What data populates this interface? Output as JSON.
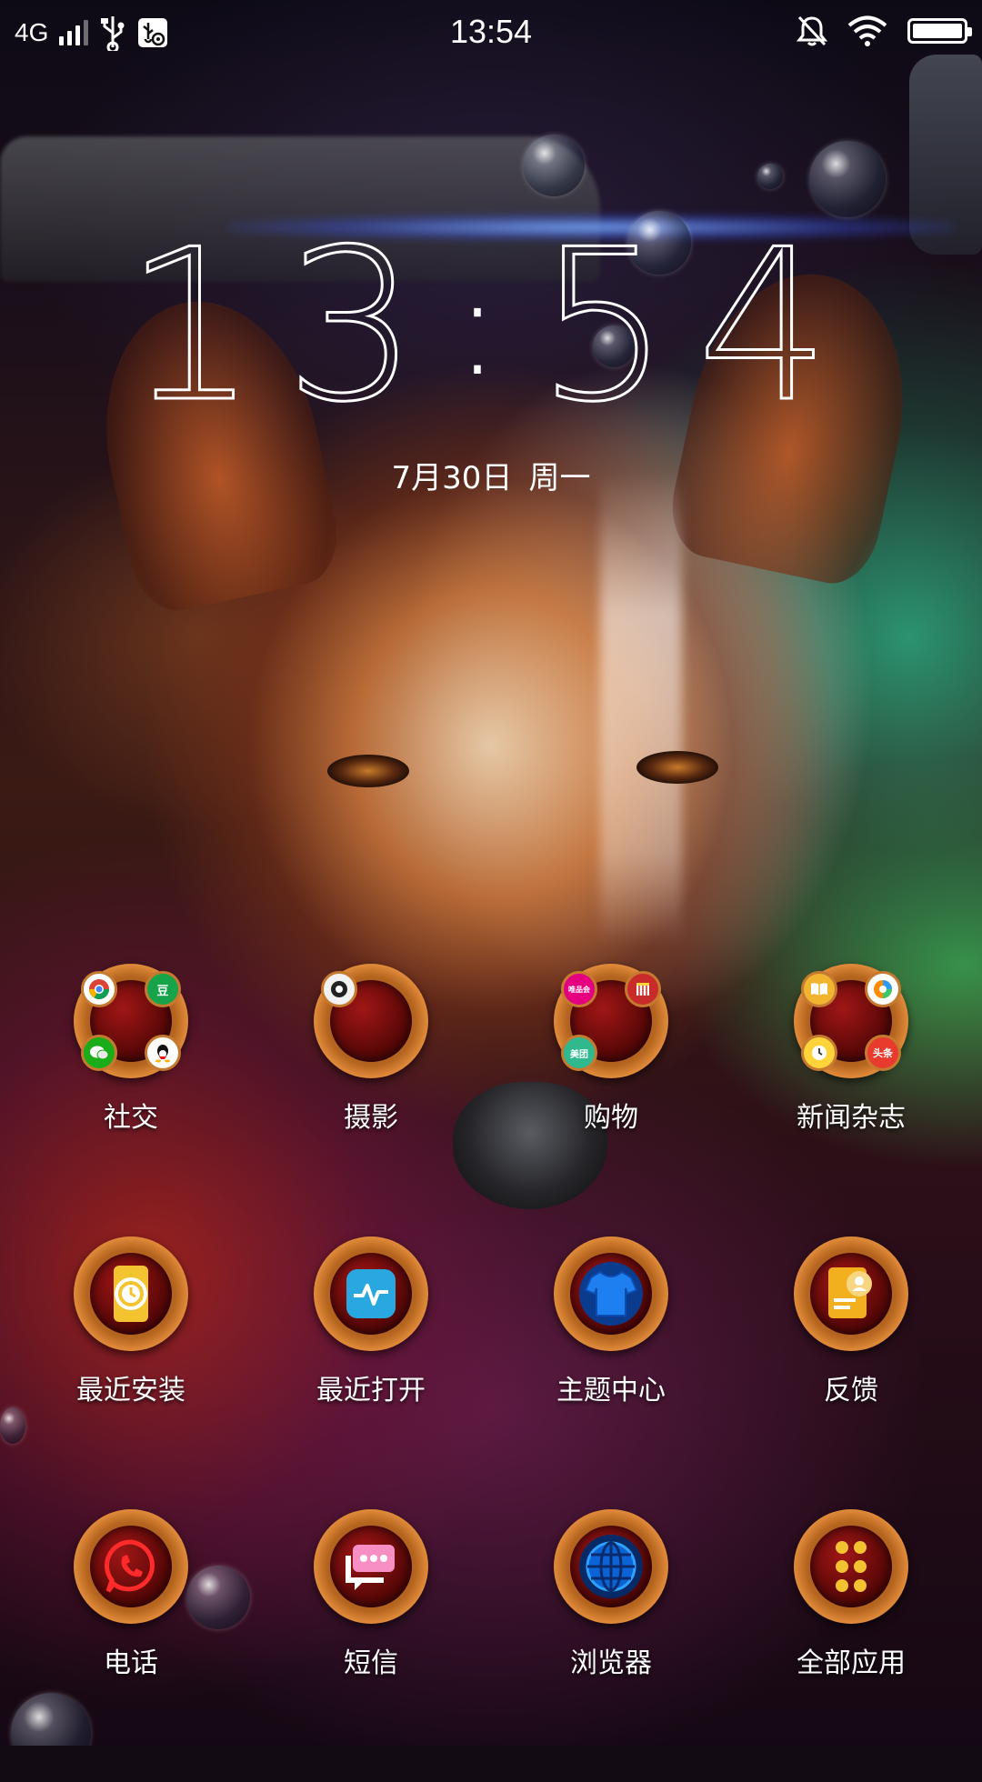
{
  "status_bar": {
    "network_type": "4G",
    "time": "13:54",
    "icons": [
      "signal-icon",
      "usb-icon",
      "usb-debug-icon",
      "notifications-off-icon",
      "wifi-icon",
      "battery-icon"
    ],
    "battery_level": 1.0
  },
  "clock_widget": {
    "hours": "13",
    "minutes": "54",
    "date": "7月30日",
    "weekday": "周一"
  },
  "apps": [
    {
      "label": "社交",
      "type": "folder",
      "icons": [
        "chrome-icon",
        "douban-icon",
        "wechat-icon",
        "qq-icon"
      ]
    },
    {
      "label": "摄影",
      "type": "folder",
      "icons": [
        "camera-icon"
      ]
    },
    {
      "label": "购物",
      "type": "folder",
      "icons": [
        "shop-icon",
        "store-icon",
        "meituan-icon"
      ],
      "badge_texts": [
        "唯品会",
        "美团"
      ]
    },
    {
      "label": "新闻杂志",
      "type": "folder",
      "icons": [
        "book-icon",
        "browser-icon",
        "clock-icon",
        "toutiao-icon"
      ],
      "badge_texts": [
        "头条"
      ]
    },
    {
      "label": "最近安装",
      "type": "app",
      "icon": "recent-install-icon"
    },
    {
      "label": "最近打开",
      "type": "app",
      "icon": "recent-open-icon"
    },
    {
      "label": "主题中心",
      "type": "app",
      "icon": "theme-center-icon"
    },
    {
      "label": "反馈",
      "type": "app",
      "icon": "feedback-icon"
    },
    {
      "label": "电话",
      "type": "app",
      "icon": "phone-icon"
    },
    {
      "label": "短信",
      "type": "app",
      "icon": "sms-icon"
    },
    {
      "label": "浏览器",
      "type": "app",
      "icon": "browser-globe-icon"
    },
    {
      "label": "全部应用",
      "type": "app",
      "icon": "all-apps-icon"
    }
  ],
  "colors": {
    "accent_ring": "#b5651f",
    "folder_core": "#5c0808",
    "text": "#ffffff"
  }
}
